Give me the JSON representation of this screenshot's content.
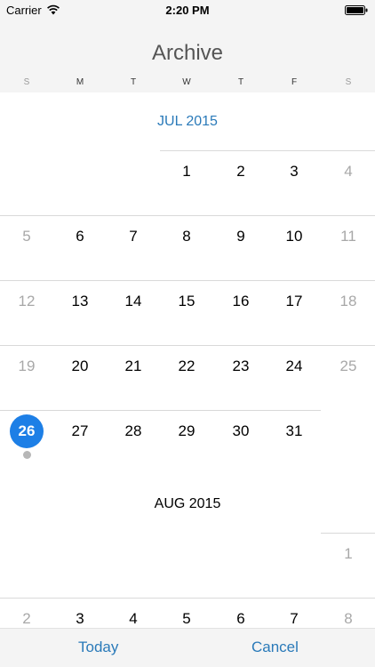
{
  "status_bar": {
    "carrier": "Carrier",
    "time": "2:20 PM",
    "wifi_icon": "wifi-icon",
    "battery_icon": "battery-icon"
  },
  "header": {
    "title": "Archive",
    "weekdays": [
      "S",
      "M",
      "T",
      "W",
      "T",
      "F",
      "S"
    ]
  },
  "months": [
    {
      "title": "JUL 2015",
      "weeks": [
        [
          "",
          "",
          "",
          "1",
          "2",
          "3",
          "4"
        ],
        [
          "5",
          "6",
          "7",
          "8",
          "9",
          "10",
          "11"
        ],
        [
          "12",
          "13",
          "14",
          "15",
          "16",
          "17",
          "18"
        ],
        [
          "19",
          "20",
          "21",
          "22",
          "23",
          "24",
          "25"
        ],
        [
          "26",
          "27",
          "28",
          "29",
          "30",
          "31",
          ""
        ]
      ]
    },
    {
      "title": "AUG 2015",
      "weeks": [
        [
          "",
          "",
          "",
          "",
          "",
          "",
          "1"
        ],
        [
          "2",
          "3",
          "4",
          "5",
          "6",
          "7",
          "8"
        ]
      ]
    }
  ],
  "selected_date": {
    "month": "JUL 2015",
    "day": "26"
  },
  "event_days": [
    {
      "month": "JUL 2015",
      "day": "26"
    }
  ],
  "colors": {
    "accent": "#2a7ab9",
    "today_fill": "#1d7fe6",
    "weekend_text": "#a8a8a8",
    "event_dot": "#b7b7b7"
  },
  "toolbar": {
    "today_label": "Today",
    "cancel_label": "Cancel"
  }
}
